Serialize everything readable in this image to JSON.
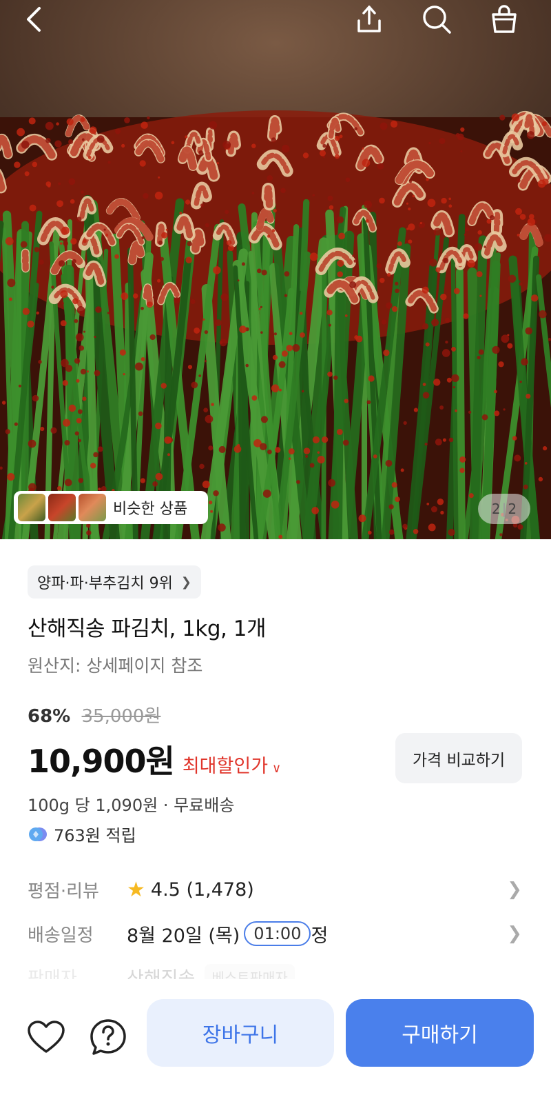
{
  "top_bar": {
    "back_icon": "chevron-left-icon",
    "share_icon": "share-icon",
    "search_icon": "search-icon",
    "cart_icon": "shopping-bag-icon"
  },
  "gallery": {
    "similar_products_label": "비슷한 상품",
    "current_index": "2",
    "separator": "|",
    "total": "2"
  },
  "product": {
    "rank_badge": "양파·파·부추김치 9위",
    "title": "산해직송 파김치, 1kg, 1개",
    "origin": "원산지: 상세페이지 참조",
    "discount_rate": "68%",
    "original_price": "35,000원",
    "price": "10,900원",
    "max_discount_label": "최대할인가",
    "compare_button": "가격 비교하기",
    "unit_price": "100g 당 1,090원",
    "dot": "·",
    "shipping": "무료배송",
    "points": "763원 적립"
  },
  "details": {
    "rating_label": "평점·리뷰",
    "rating_value": "4.5",
    "review_count": "(1,478)",
    "delivery_label": "배송일정",
    "delivery_date": "8월 20일 (목)",
    "delivery_time": "01:00",
    "delivery_suffix": "정",
    "seller_label": "판매자",
    "seller_name": "산해직송",
    "seller_badge": "베스트판매자"
  },
  "bottom_bar": {
    "wishlist_icon": "heart-icon",
    "inquiry_icon": "question-icon",
    "cart_button": "장바구니",
    "buy_button": "구매하기"
  },
  "colors": {
    "accent_blue": "#4a80ec",
    "cart_bg": "#e9f0fd",
    "discount_red": "#e0352b",
    "star_yellow": "#f6b921"
  }
}
